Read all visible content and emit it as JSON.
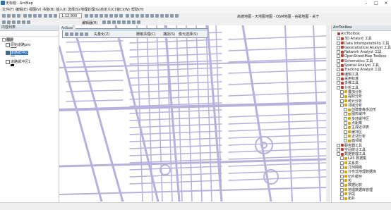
{
  "window": {
    "title": "无标题 - ArcMap"
  },
  "menu": [
    "文件(F)",
    "编辑(E)",
    "视图(V)",
    "书签(B)",
    "插入(I)",
    "选择(S)",
    "地理处理(G)",
    "自定义(C)",
    "窗口(W)",
    "帮助(H)"
  ],
  "toolbar": {
    "scale": "1:12,900",
    "right_links": "高德地图 - 天地图地图 - OSM地图 - 谷歌地图 - 关于",
    "editor_label": "编辑器(R)",
    "float_items": [
      "矢量化(Z)",
      "栅格清理(C)",
      "捕捉(S)",
      "像元选择(S)"
    ]
  },
  "toc": {
    "title": "内容列表",
    "layers": [
      {
        "label": "图层",
        "bold": true
      },
      {
        "label": "原始道路pro"
      },
      {
        "label": "道路缓冲区"
      },
      {
        "label": "道路缓冲区1"
      }
    ]
  },
  "map": {
    "window_label": "ArcScan",
    "road_color": "#b9b0dc"
  },
  "toolbox": {
    "title": "ArcToolbox",
    "items": [
      {
        "label": "ArcToolbox",
        "level": 0,
        "type": "root"
      },
      {
        "label": "3D Analyst 工具",
        "level": 1,
        "type": "box"
      },
      {
        "label": "Data Interoperability 工具",
        "level": 1,
        "type": "box"
      },
      {
        "label": "Geostatistical Analyst 工具",
        "level": 1,
        "type": "box"
      },
      {
        "label": "Network Analyst 工具",
        "level": 1,
        "type": "box"
      },
      {
        "label": "OpenStreetMap Toolbox",
        "level": 1,
        "type": "box"
      },
      {
        "label": "Schematics 工具",
        "level": 1,
        "type": "box"
      },
      {
        "label": "Spatial Analyst 工具",
        "level": 1,
        "type": "box"
      },
      {
        "label": "Tracking Analyst 工具",
        "level": 1,
        "type": "box"
      },
      {
        "label": "编辑工具",
        "level": 1,
        "type": "box"
      },
      {
        "label": "采用标准",
        "level": 1,
        "type": "box"
      },
      {
        "label": "多维工具",
        "level": 1,
        "type": "box"
      },
      {
        "label": "分析工具",
        "level": 1,
        "type": "box",
        "expanded": true
      },
      {
        "label": "叠加分析",
        "level": 2,
        "type": "tool"
      },
      {
        "label": "提取分析",
        "level": 2,
        "type": "tool"
      },
      {
        "label": "统计分析",
        "level": 2,
        "type": "tool"
      },
      {
        "label": "邻域分析",
        "level": 2,
        "type": "tool",
        "expanded": true
      },
      {
        "label": "创建泰森多边形",
        "level": 3,
        "type": "tool"
      },
      {
        "label": "图形缓冲",
        "level": 3,
        "type": "tool"
      },
      {
        "label": "多环缓冲区",
        "level": 3,
        "type": "tool"
      },
      {
        "label": "点距离",
        "level": 3,
        "type": "tool"
      },
      {
        "label": "生成近邻表",
        "level": 3,
        "type": "tool"
      },
      {
        "label": "缓冲区",
        "level": 3,
        "type": "tool"
      },
      {
        "label": "近邻分析",
        "level": 3,
        "type": "tool"
      },
      {
        "label": "面邻域",
        "level": 3,
        "type": "tool"
      },
      {
        "label": "服务器工具",
        "level": 1,
        "type": "box"
      },
      {
        "label": "空间统计工具",
        "level": 1,
        "type": "box"
      },
      {
        "label": "数据管理工具",
        "level": 1,
        "type": "box",
        "expanded": true
      },
      {
        "label": "LAS 数据集",
        "level": 2,
        "type": "tool"
      },
      {
        "label": "关系类",
        "level": 2,
        "type": "tool"
      },
      {
        "label": "几何网络",
        "level": 2,
        "type": "tool"
      },
      {
        "label": "分布式地理数据库",
        "level": 2,
        "type": "tool"
      },
      {
        "label": "切片缓存",
        "level": 2,
        "type": "tool"
      },
      {
        "label": "包",
        "level": 2,
        "type": "tool"
      },
      {
        "label": "数据比较",
        "level": 2,
        "type": "tool"
      },
      {
        "label": "地理数据库管理",
        "level": 2,
        "type": "tool"
      },
      {
        "label": "字段",
        "level": 2,
        "type": "tool"
      },
      {
        "label": "拓扑",
        "level": 2,
        "type": "tool"
      }
    ]
  }
}
